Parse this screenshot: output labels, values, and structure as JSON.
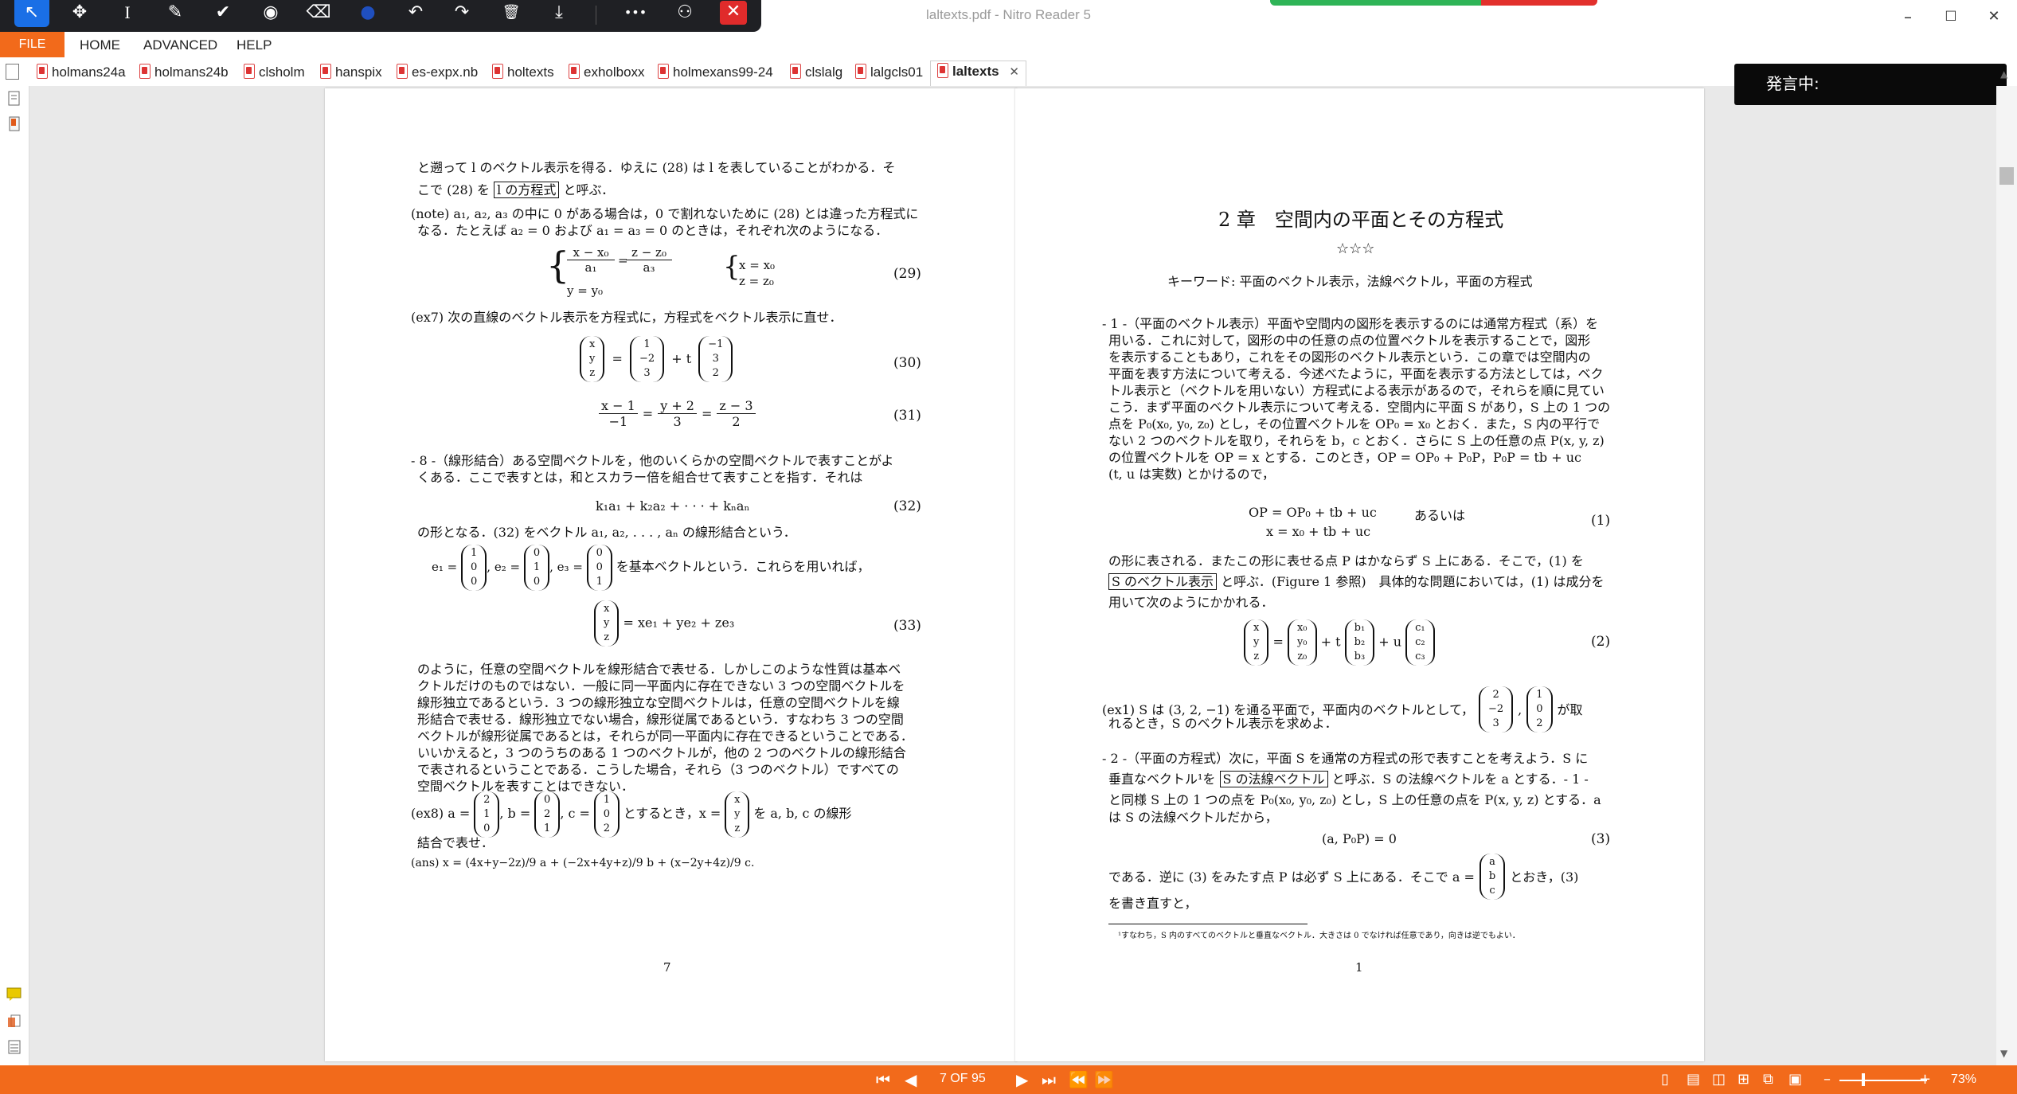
{
  "window": {
    "title": "laltexts.pdf - Nitro Reader 5",
    "minimize": "–",
    "maximize": "☐",
    "close": "✕"
  },
  "toolbar": {
    "tools": [
      {
        "icon": "pointer-icon",
        "glyph": "↖"
      },
      {
        "icon": "move-icon",
        "glyph": "✥"
      },
      {
        "icon": "text-cursor-icon",
        "glyph": "I"
      },
      {
        "icon": "pen-icon",
        "glyph": "✎"
      },
      {
        "icon": "check-icon",
        "glyph": "✔"
      },
      {
        "icon": "stamp-icon",
        "glyph": "◉"
      },
      {
        "icon": "eraser-icon",
        "glyph": "⌫"
      },
      {
        "icon": "color-dot-icon",
        "glyph": "●"
      },
      {
        "icon": "undo-icon",
        "glyph": "↶"
      },
      {
        "icon": "redo-icon",
        "glyph": "↷"
      },
      {
        "icon": "trash-icon",
        "glyph": "🗑"
      },
      {
        "icon": "download-icon",
        "glyph": "⤓"
      },
      {
        "icon": "more-icon",
        "glyph": "•••"
      },
      {
        "icon": "user-settings-icon",
        "glyph": "⚇"
      },
      {
        "icon": "close-icon",
        "glyph": "✕"
      }
    ]
  },
  "menu": {
    "file": "FILE",
    "items": [
      "HOME",
      "ADVANCED",
      "HELP"
    ]
  },
  "tabs": [
    "holmans24a",
    "holmans24b",
    "clsholm",
    "hanspix",
    "es-expx.nb",
    "holtexts",
    "exholboxx",
    "holmexans99-24",
    "clslalg",
    "lalgcls01",
    "laltexts"
  ],
  "active_tab_close": "✕",
  "speaking": "発言中:",
  "status": {
    "page_indicator": "7 OF 95",
    "zoom": "73%",
    "zoom_minus": "–",
    "zoom_plus": "+"
  },
  "page_left": {
    "p1a": "と遡って l のベクトル表示を得る．ゆえに (28) は l を表していることがわかる．そ",
    "p1b": "こで (28) を",
    "p1box": "l の方程式",
    "p1c": "と呼ぶ．",
    "note1": "(note) a₁, a₂, a₃ の中に 0 がある場合は，0 で割れないために (28) とは違った方程式に",
    "note2": "なる．たとえば a₂ = 0 および a₁ = a₃ = 0 のときは，それぞれ次のようになる．",
    "eq29a_num1": "x − x₀",
    "eq29a_den1": "a₁",
    "eq29a_num2": "z − z₀",
    "eq29a_den2": "a₃",
    "eq29b": "y = y₀",
    "eq29c": "x = x₀",
    "eq29d": "z = z₀",
    "eq29": "(29)",
    "ex7": "(ex7) 次の直線のベクトル表示を方程式に，方程式をベクトル表示に直せ．",
    "eq30_v1": [
      "x",
      "y",
      "z"
    ],
    "eq30_v2": [
      "1",
      "−2",
      "3"
    ],
    "eq30_v3": [
      "−1",
      "3",
      "2"
    ],
    "eq30_eq": "=",
    "eq30_t": "+ t",
    "eq30": "(30)",
    "eq31_n1": "x − 1",
    "eq31_d1": "−1",
    "eq31_n2": "y + 2",
    "eq31_d2": "3",
    "eq31_n3": "z − 3",
    "eq31_d3": "2",
    "eq31": "(31)",
    "sec8a": "- 8 -（線形結合）ある空間ベクトルを，他のいくらかの空間ベクトルで表すことがよ",
    "sec8b": "くある．ここで表すとは，和とスカラー倍を組合せて表すことを指す．それは",
    "eq32_body": "k₁a₁ + k₂a₂ + · · · + kₙaₙ",
    "eq32": "(32)",
    "lc": "の形となる．(32) をベクトル a₁, a₂, . . . , aₙ の線形結合という．",
    "e1": "e₁ =",
    "e2": ", e₂ =",
    "e3": ", e₃ =",
    "e1v": [
      "1",
      "0",
      "0"
    ],
    "e2v": [
      "0",
      "1",
      "0"
    ],
    "e3v": [
      "0",
      "0",
      "1"
    ],
    "basis": "を基本ベクトルという．これらを用いれば，",
    "eq33_v": [
      "x",
      "y",
      "z"
    ],
    "eq33_body": "= xe₁ + ye₂ + ze₃",
    "eq33": "(33)",
    "lin": [
      "のように，任意の空間ベクトルを線形結合で表せる．しかしこのような性質は基本ベ",
      "クトルだけのものではない．一般に同一平面内に存在できない 3 つの空間ベクトルを",
      "線形独立であるという．3 つの線形独立な空間ベクトルは，任意の空間ベクトルを線",
      "形結合で表せる．線形独立でない場合，線形従属であるという．すなわち 3 つの空間",
      "ベクトルが線形従属であるとは，それらが同一平面内に存在できるということである．",
      "いいかえると，3 つのうちのある 1 つのベクトルが，他の 2 つのベクトルの線形結合",
      "で表されるということである．こうした場合，それら（3 つのベクトル）ですべての",
      "空間ベクトルを表すことはできない．"
    ],
    "ex8_a": "(ex8) a =",
    "ex8_av": [
      "2",
      "1",
      "0"
    ],
    "ex8_b": ", b =",
    "ex8_bv": [
      "0",
      "2",
      "1"
    ],
    "ex8_c": ", c =",
    "ex8_cv": [
      "1",
      "0",
      "2"
    ],
    "ex8_x": "とするとき，x =",
    "ex8_xv": [
      "x",
      "y",
      "z"
    ],
    "ex8_tail": "を a, b, c の線形",
    "ex8_2": "結合で表せ．",
    "ans": "(ans) x = (4x+y−2z)/9 a + (−2x+4y+z)/9 b + (x−2y+4z)/9 c.",
    "page_no": "7"
  },
  "page_right": {
    "chapter": "2 章　空間内の平面とその方程式",
    "stars": "☆☆☆",
    "keywords": "キーワード: 平面のベクトル表示，法線ベクトル，平面の方程式",
    "s1": [
      "- 1 -（平面のベクトル表示）平面や空間内の図形を表示するのには通常方程式（系）を",
      "用いる．これに対して，図形の中の任意の点の位置ベクトルを表示することで，図形",
      "を表示することもあり，これをその図形のベクトル表示という．この章では空間内の",
      "平面を表す方法について考える．今述べたように，平面を表示する方法としては，ベク",
      "トル表示と（ベクトルを用いない）方程式による表示があるので，それらを順に見てい",
      "こう．まず平面のベクトル表示について考える．空間内に平面 S があり，S 上の 1 つの",
      "点を P₀(x₀, y₀, z₀) とし，その位置ベクトルを OP₀ = x₀ とおく．また，S 内の平行で",
      "ない 2 つのベクトルを取り，それらを b，c とおく．さらに S 上の任意の点 P(x, y, z)",
      "の位置ベクトルを OP = x とする．このとき，OP = OP₀ + P₀P，P₀P = tb + uc",
      "(t, u は実数) とかけるので，"
    ],
    "eq1a": "OP   = OP₀ + tb + uc",
    "eq1or": "あるいは",
    "eq1b": "x   = x₀ + tb + uc",
    "eq1": "(1)",
    "after1a": "の形に表される．またこの形に表せる点 P はかならず S 上にある．そこで，(1) を",
    "after1box": "S のベクトル表示",
    "after1b": "と呼ぶ．(Figure 1 参照)　具体的な問題においては，(1) は成分を",
    "after1c": "用いて次のようにかかれる．",
    "eq2_v1": [
      "x",
      "y",
      "z"
    ],
    "eq2_v2": [
      "x₀",
      "y₀",
      "z₀"
    ],
    "eq2_v3": [
      "b₁",
      "b₂",
      "b₃"
    ],
    "eq2_v4": [
      "c₁",
      "c₂",
      "c₃"
    ],
    "eq2_eq": "=",
    "eq2_t": "+ t",
    "eq2_u": "+ u",
    "eq2": "(2)",
    "ex1a": "(ex1) S は (3, 2, −1) を通る平面で，平面内のベクトルとして，",
    "ex1_v1": [
      "2",
      "−2",
      "3"
    ],
    "ex1_comma": ",",
    "ex1_v2": [
      "1",
      "0",
      "2"
    ],
    "ex1b": "が取",
    "ex1c": "れるとき，S のベクトル表示を求めよ．",
    "s2a": "- 2 -（平面の方程式）次に，平面 S を通常の方程式の形で表すことを考えよう．S に",
    "s2b": "垂直なベクトル¹を",
    "s2box": "S の法線ベクトル",
    "s2c": "と呼ぶ．S の法線ベクトルを a とする．- 1 -",
    "s2d": "と同様 S 上の 1 つの点を P₀(x₀, y₀, z₀) とし，S 上の任意の点を P(x, y, z) とする．a",
    "s2e": "は S の法線ベクトルだから，",
    "eq3_body": "(a, P₀P) = 0",
    "eq3": "(3)",
    "after3a": "である．逆に (3) をみたす点 P は必ず S 上にある．そこで a =",
    "after3v": [
      "a",
      "b",
      "c"
    ],
    "after3b": "とおき，(3)",
    "after3c": "を書き直すと，",
    "footnote": "¹すなわち，S 内のすべてのベクトルと垂直なベクトル．大きさは 0 でなければ任意であり，向きは逆でもよい．",
    "page_no": "1"
  }
}
